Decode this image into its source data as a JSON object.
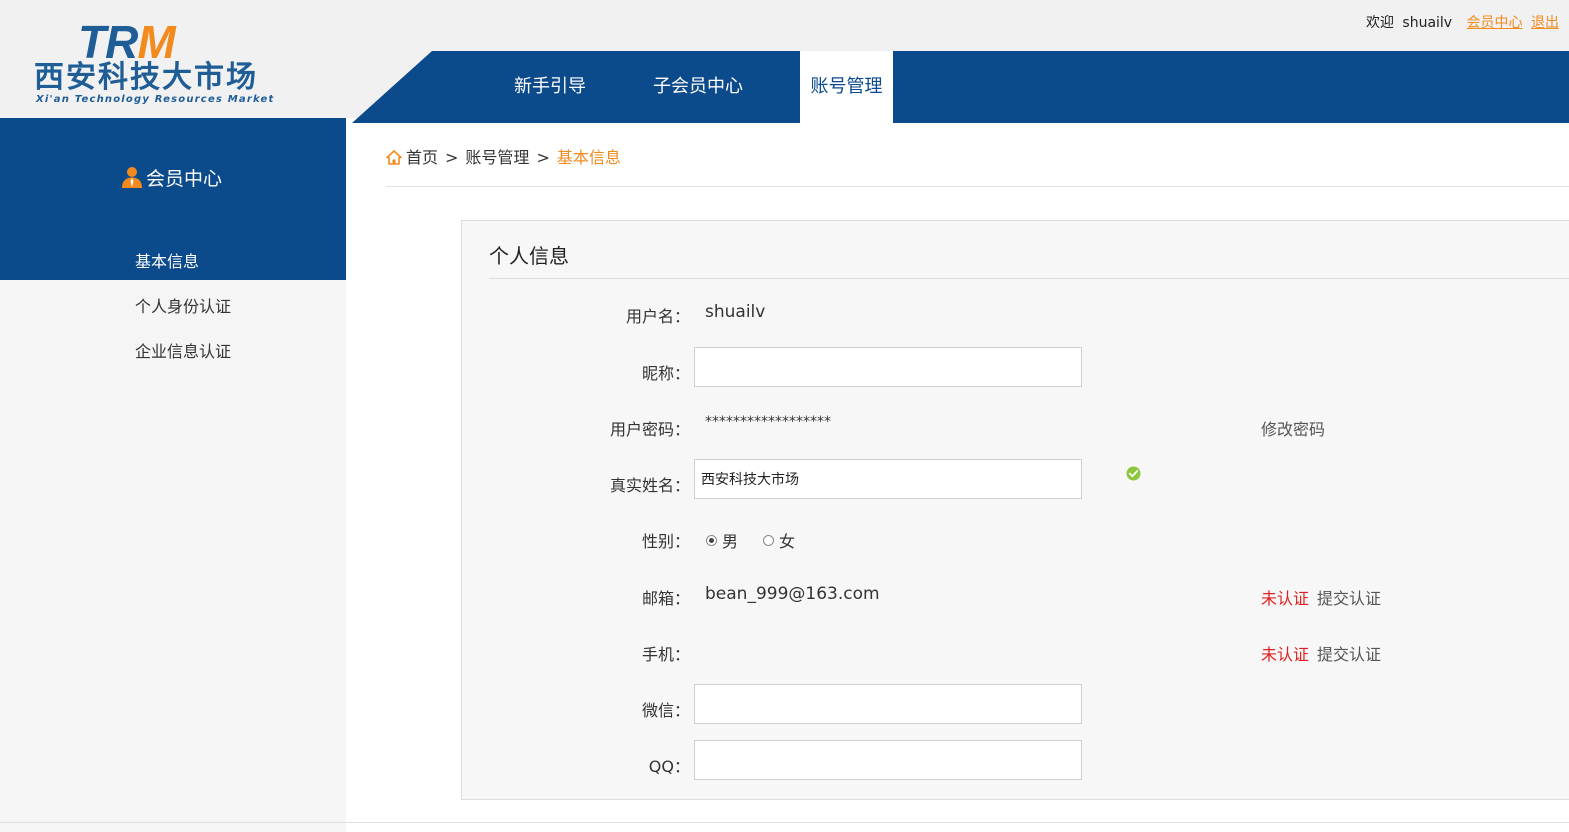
{
  "logo": {
    "trm_t": "TR",
    "trm_m": "M",
    "cn": "西安科技大市场",
    "en": "Xi'an Technology Resources Market"
  },
  "userbar": {
    "welcome": "欢迎",
    "username": "shuailv",
    "member_center": "会员中心",
    "logout": "退出"
  },
  "nav": {
    "items": [
      "新手引导",
      "子会员中心",
      "账号管理"
    ],
    "active": "账号管理"
  },
  "sidebar": {
    "title": "会员中心",
    "items": [
      "基本信息",
      "个人身份认证",
      "企业信息认证"
    ],
    "active": "基本信息"
  },
  "breadcrumb": {
    "home": "首页",
    "sep": ">",
    "level2": "账号管理",
    "current": "基本信息"
  },
  "panel": {
    "title": "个人信息",
    "fields": {
      "username": {
        "label": "用户名：",
        "value": "shuailv"
      },
      "nickname": {
        "label": "昵称：",
        "value": ""
      },
      "password": {
        "label": "用户密码：",
        "value": "******************",
        "action": "修改密码"
      },
      "realname": {
        "label": "真实姓名：",
        "value": "西安科技大市场"
      },
      "gender": {
        "label": "性别：",
        "options": [
          "男",
          "女"
        ],
        "selected": "男"
      },
      "email": {
        "label": "邮箱：",
        "value": "bean_999@163.com",
        "status": "未认证",
        "action": "提交认证"
      },
      "mobile": {
        "label": "手机：",
        "value": "",
        "status": "未认证",
        "action": "提交认证"
      },
      "wechat": {
        "label": "微信：",
        "value": ""
      },
      "qq": {
        "label": "QQ：",
        "value": ""
      }
    }
  },
  "colors": {
    "brand_blue": "#0b4a8b",
    "accent_orange": "#f28a1e",
    "status_red": "#e02020",
    "ok_green": "#8cc63f"
  }
}
